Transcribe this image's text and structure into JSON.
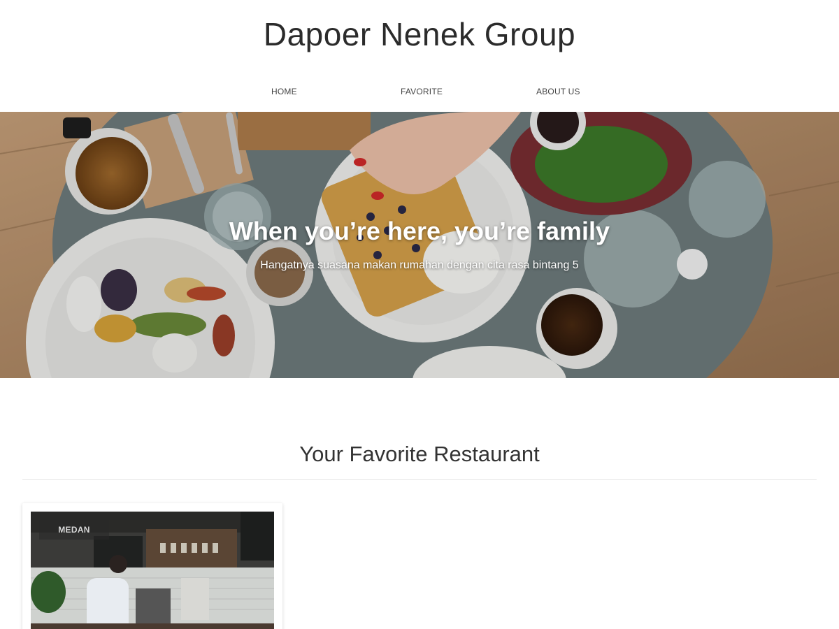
{
  "header": {
    "title": "Dapoer Nenek Group",
    "nav": [
      {
        "label": "HOME"
      },
      {
        "label": "FAVORITE"
      },
      {
        "label": "ABOUT US"
      }
    ]
  },
  "hero": {
    "title": "When you’re here, you’re family",
    "subtitle": "Hangatnya suasana makan rumahan dengan cita rasa bintang 5"
  },
  "section": {
    "title": "Your Favorite Restaurant"
  },
  "restaurants": [
    {
      "city": "MEDAN"
    }
  ],
  "colors": {
    "table": "#6f7d7e",
    "wood": "#b9946c",
    "text": "#333333"
  }
}
